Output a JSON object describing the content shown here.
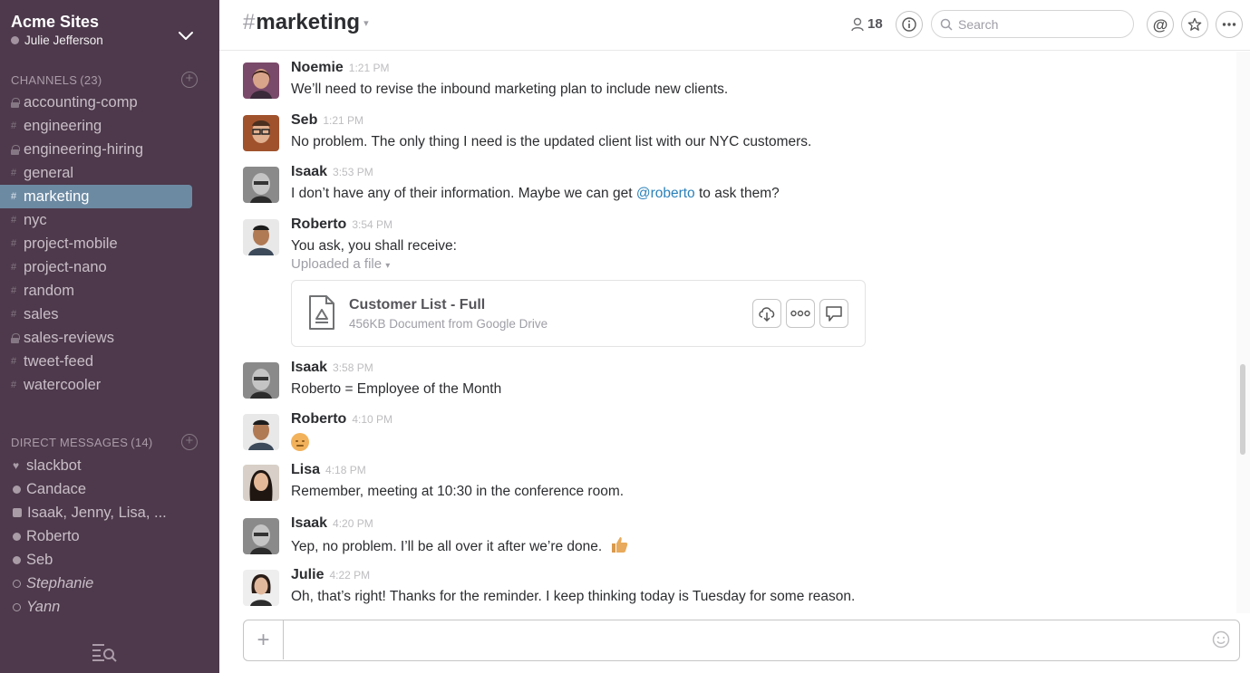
{
  "team": {
    "name": "Acme Sites",
    "user": "Julie Jefferson"
  },
  "channels_section": {
    "label": "CHANNELS",
    "count": "(23)"
  },
  "channels": [
    {
      "name": "accounting-comp",
      "private": true
    },
    {
      "name": "engineering",
      "private": false
    },
    {
      "name": "engineering-hiring",
      "private": true
    },
    {
      "name": "general",
      "private": false
    },
    {
      "name": "marketing",
      "private": false,
      "active": true
    },
    {
      "name": "nyc",
      "private": false
    },
    {
      "name": "project-mobile",
      "private": false
    },
    {
      "name": "project-nano",
      "private": false
    },
    {
      "name": "random",
      "private": false
    },
    {
      "name": "sales",
      "private": false
    },
    {
      "name": "sales-reviews",
      "private": true
    },
    {
      "name": "tweet-feed",
      "private": false
    },
    {
      "name": "watercooler",
      "private": false
    }
  ],
  "dm_section": {
    "label": "DIRECT MESSAGES",
    "count": "(14)"
  },
  "dms": [
    {
      "name": "slackbot",
      "status": "heart"
    },
    {
      "name": "Candace",
      "status": "online"
    },
    {
      "name": "Isaak, Jenny, Lisa, ...",
      "status": "group"
    },
    {
      "name": "Roberto",
      "status": "online"
    },
    {
      "name": "Seb",
      "status": "online"
    },
    {
      "name": "Stephanie",
      "status": "away"
    },
    {
      "name": "Yann",
      "status": "away"
    }
  ],
  "header": {
    "hash": "#",
    "channel": "marketing",
    "member_count": "18",
    "search_placeholder": "Search"
  },
  "messages": [
    {
      "author": "Noemie",
      "time": "1:21 PM",
      "text": "We’ll need to revise the inbound marketing plan to include new clients."
    },
    {
      "author": "Seb",
      "time": "1:21 PM",
      "text": "No problem. The only thing I need is the updated client list with our NYC customers."
    },
    {
      "author": "Isaak",
      "time": "3:53 PM",
      "text_before": "I don’t have any of their information. Maybe we can get ",
      "mention": "@roberto",
      "text_after": " to ask them?"
    },
    {
      "author": "Roberto",
      "time": "3:54 PM",
      "text": "You ask, you shall receive:",
      "sub": "Uploaded a file"
    },
    {
      "author": "Isaak",
      "time": "3:58 PM",
      "text": "Roberto = Employee of the Month"
    },
    {
      "author": "Roberto",
      "time": "4:10 PM",
      "emoji": "smiley"
    },
    {
      "author": "Lisa",
      "time": "4:18 PM",
      "text": "Remember, meeting at 10:30 in the conference room."
    },
    {
      "author": "Isaak",
      "time": "4:20 PM",
      "text": "Yep, no problem. I’ll be all over it after we’re done.",
      "emoji": "thumbs-up"
    },
    {
      "author": "Julie",
      "time": "4:22 PM",
      "text": "Oh, that’s right! Thanks for the reminder. I keep thinking today is Tuesday for some reason."
    }
  ],
  "file": {
    "title": "Customer List - Full",
    "subtitle": "456KB Document from Google Drive"
  },
  "composer": {
    "placeholder": ""
  },
  "colors": {
    "sidebar_bg": "#4d394b",
    "active_channel": "#6d8aa3",
    "mention": "#2a80b9"
  },
  "icons": [
    "chevron-down-icon",
    "lock-icon",
    "hash-icon",
    "plus-icon",
    "member-icon",
    "info-icon",
    "search-icon",
    "mention-icon",
    "star-icon",
    "more-icon",
    "google-drive-icon",
    "download-icon",
    "comment-icon",
    "emoji-icon",
    "quick-switcher-icon"
  ]
}
